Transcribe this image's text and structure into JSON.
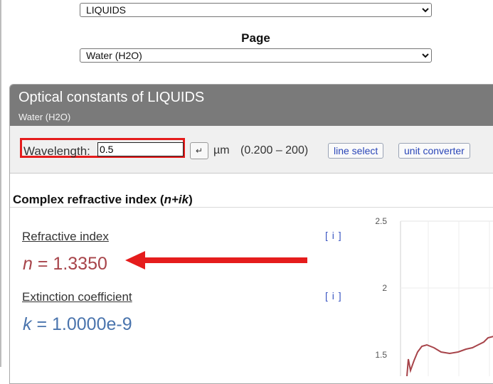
{
  "shelf": {
    "selected": "LIQUIDS"
  },
  "page": {
    "label": "Page",
    "selected": "Water (H2O)"
  },
  "panel": {
    "title": "Optical constants of LIQUIDS",
    "subtitle": "Water (H2O)",
    "header_bg": "#7a7a7a"
  },
  "wavelength": {
    "label": "Wavelength:",
    "value": "0.5",
    "enter_symbol": "↵",
    "unit": "µm",
    "range": "(0.200 – 200)",
    "line_select_label": "line select",
    "unit_converter_label": "unit converter"
  },
  "complex_index": {
    "title_prefix": "Complex refractive index (",
    "title_formula": "n+ik",
    "title_suffix": ")"
  },
  "refractive": {
    "label": "Refractive index",
    "info": "[ i ]",
    "symbol": "n",
    "equals": "=",
    "value": "1.3350",
    "color": "#a7444a"
  },
  "extinction": {
    "label": "Extinction coefficient",
    "info": "[ i ]",
    "symbol": "k",
    "equals": "=",
    "value": "1.0000e-9",
    "color": "#4a74ad"
  },
  "chart": {
    "y_ticks": [
      "2.5",
      "2",
      "1.5"
    ]
  },
  "annotations": {
    "highlight_color": "#e51c1c"
  }
}
